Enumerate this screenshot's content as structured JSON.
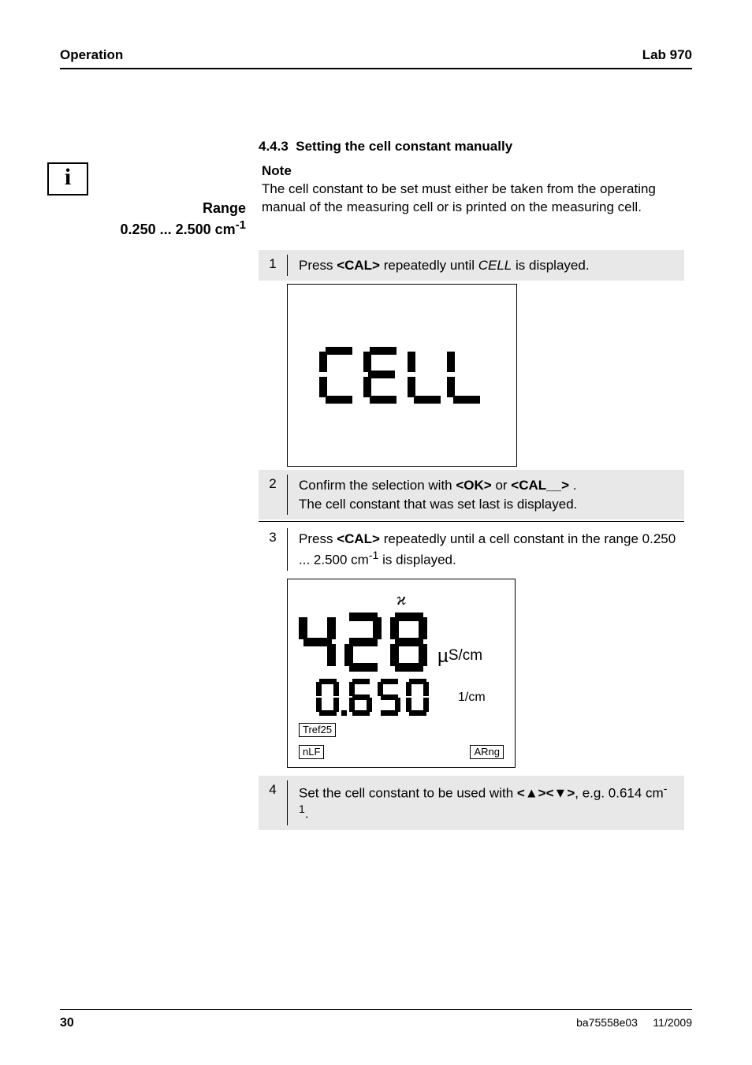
{
  "header": {
    "left": "Operation",
    "right": "Lab 970"
  },
  "section": {
    "number": "4.4.3",
    "title": "Setting the cell constant manually"
  },
  "note": {
    "label": "Note",
    "body": "The cell constant to be set must either be taken from the operating manual of the measuring cell or is printed on the measuring cell."
  },
  "range": {
    "label": "Range",
    "value_prefix": "0.250 ... 2.500 cm",
    "value_exp": "-1"
  },
  "steps": {
    "s1": {
      "num": "1",
      "pre": "Press ",
      "kbd": "<CAL>",
      "mid": " repeatedly until ",
      "ital": "CELL",
      "post": " is displayed."
    },
    "s2": {
      "num": "2",
      "pre": "Confirm the selection with ",
      "kbd1": "<OK>",
      "mid1": " or ",
      "kbd2": "<CAL__>",
      "post1": " .",
      "line2": "The cell constant that was set last is displayed."
    },
    "s3": {
      "num": "3",
      "pre": "Press ",
      "kbd": "<CAL>",
      "mid": " repeatedly until a cell constant in the range 0.250 ... 2.500 cm",
      "exp": "-1",
      "post": " is displayed."
    },
    "s4": {
      "num": "4",
      "pre": "Set the cell constant to be used with ",
      "kbd": "<▲><▼>",
      "mid": ", e.g. 0.614 cm",
      "exp": "-1",
      "post": "."
    }
  },
  "lcd1": {
    "text": "CELL"
  },
  "lcd2": {
    "kappa": "ϰ",
    "big_value": "428",
    "big_unit_mu": "µ",
    "big_unit_rest": "S/cm",
    "small_value": "0.650",
    "small_unit": "1/cm",
    "tref": "Tref25",
    "nlf": "nLF",
    "arng": "ARng"
  },
  "footer": {
    "page": "30",
    "code": "ba75558e03",
    "date": "11/2009"
  }
}
